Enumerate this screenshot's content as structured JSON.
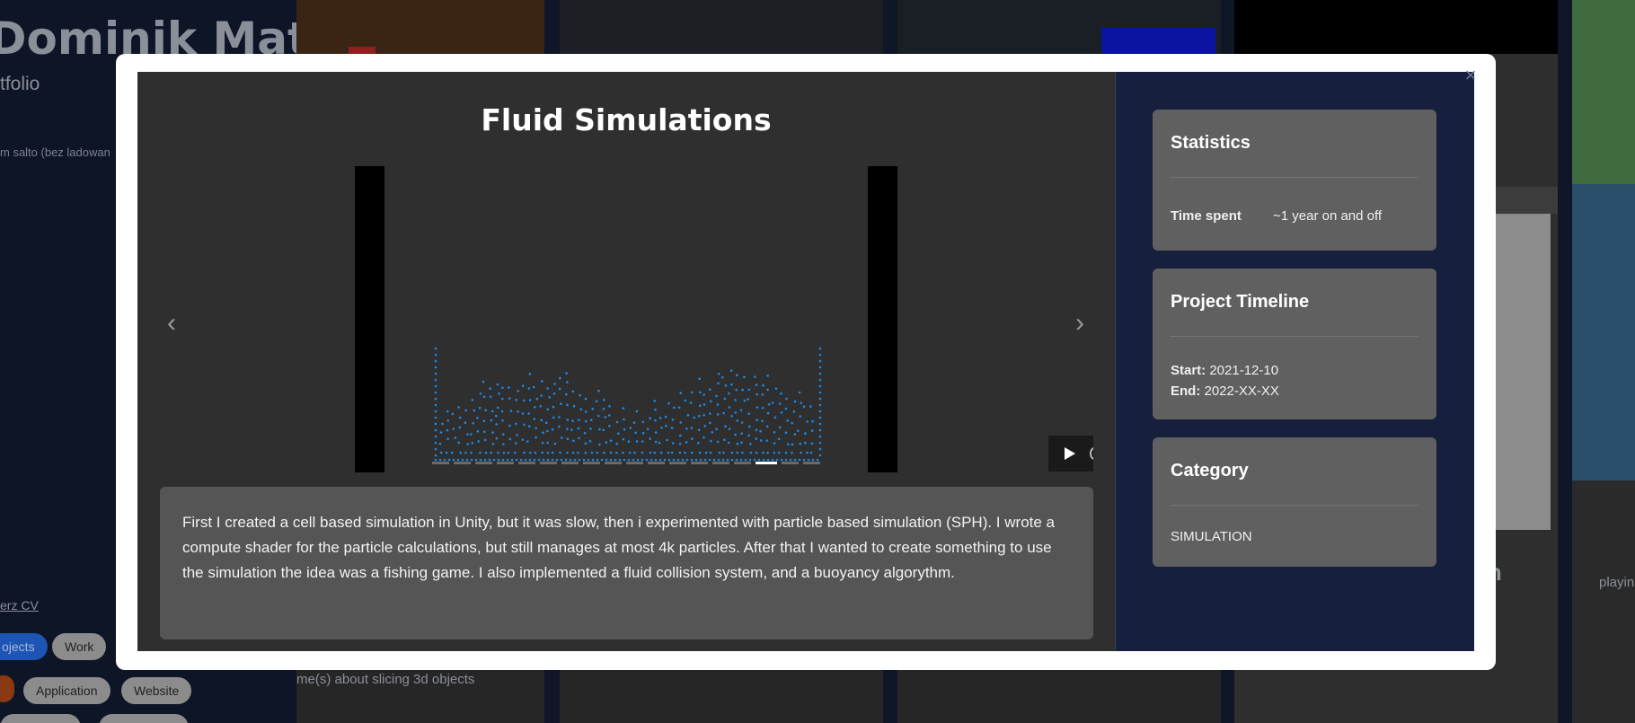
{
  "background": {
    "name": "Dominik Mat",
    "subtitle": "tfolio",
    "snippet": "m salto (bez ladowan",
    "cv_link": "erz CV",
    "tags": {
      "projects": "ojects",
      "work": "Work",
      "application": "Application",
      "website": "Website"
    },
    "card_caption": "me(s) about slicing 3d objects",
    "right_title_fragment": "on",
    "right_text_fragment": "playin"
  },
  "modal": {
    "title": "Fluid Simulations",
    "description": "First I created a cell based simulation in Unity, but it was slow, then i experimented with particle based simulation (SPH). I wrote a compute shader for the particle calculations, but still manages at most 4k particles. After that I wanted to create something to use the simulation the idea was a fishing game. I also implemented a fluid collision system, and a buoyancy algorythm.",
    "carousel": {
      "slide_count": 18,
      "active_index": 15
    },
    "statistics": {
      "title": "Statistics",
      "time_spent_label": "Time spent",
      "time_spent_value": "~1 year on and off"
    },
    "timeline": {
      "title": "Project Timeline",
      "start_label": "Start:",
      "start_value": "2021-12-10",
      "end_label": "End:",
      "end_value": "2022-XX-XX"
    },
    "category": {
      "title": "Category",
      "value": "SIMULATION"
    },
    "close_symbol": "×",
    "prev_symbol": "‹",
    "next_symbol": "›"
  },
  "colors": {
    "overlay": "#0e1628",
    "modal_main": "#2f2f2f",
    "modal_side": "#16203c",
    "card": "#606060",
    "particle": "#1e88e5",
    "active_tag": "#1d55b5"
  },
  "icons": {
    "prev": "chevron-left-icon",
    "next": "chevron-right-icon",
    "play": "play-icon",
    "close": "close-icon"
  }
}
